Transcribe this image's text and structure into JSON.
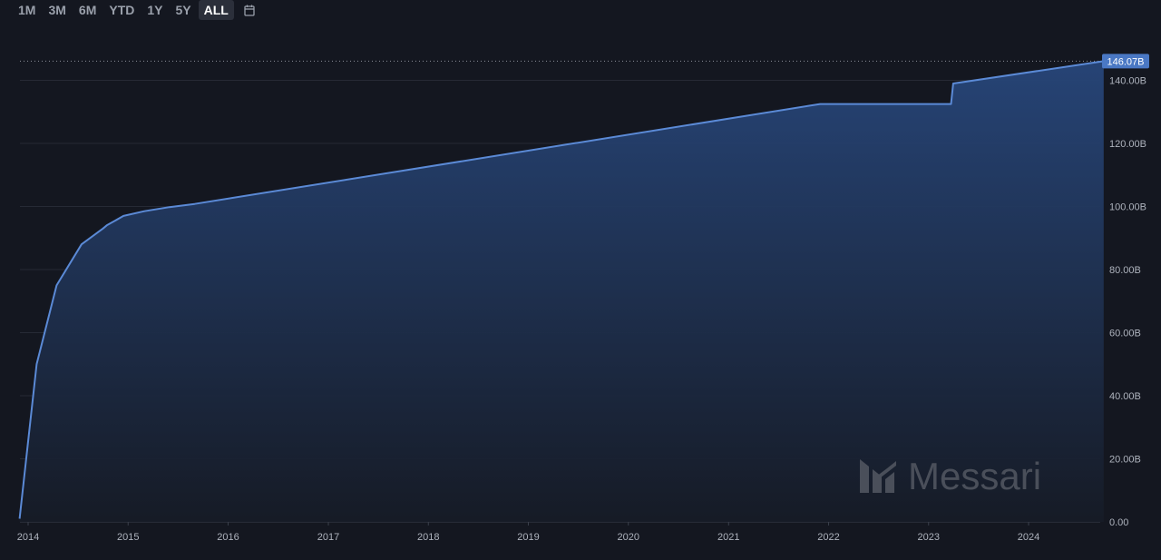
{
  "range_selector": {
    "buttons": [
      {
        "label": "1M",
        "active": false
      },
      {
        "label": "3M",
        "active": false
      },
      {
        "label": "6M",
        "active": false
      },
      {
        "label": "YTD",
        "active": false
      },
      {
        "label": "1Y",
        "active": false
      },
      {
        "label": "5Y",
        "active": false
      },
      {
        "label": "ALL",
        "active": true
      }
    ],
    "calendar_icon": "calendar-icon"
  },
  "watermark": "Messari",
  "colors": {
    "background": "#141720",
    "line": "#5b8ad6",
    "area_top": "#27467a",
    "area_bottom": "#161b26",
    "grid": "#262a35",
    "last_value_badge": "#4a78c4"
  },
  "chart_data": {
    "type": "area",
    "title": "",
    "xlabel": "",
    "ylabel": "",
    "x_ticks": [
      "2014",
      "2015",
      "2016",
      "2017",
      "2018",
      "2019",
      "2020",
      "2021",
      "2022",
      "2023",
      "2024"
    ],
    "y_ticks": [
      "0.00",
      "20.00B",
      "40.00B",
      "60.00B",
      "80.00B",
      "100.00B",
      "120.00B",
      "140.00B"
    ],
    "ylim": [
      0,
      160
    ],
    "y_unit": "B",
    "last_value_label": "146.07B",
    "grid": true,
    "series": [
      {
        "points": [
          {
            "x": "2013-12-01",
            "y": 1.0
          },
          {
            "x": "2014-02-01",
            "y": 50.0
          },
          {
            "x": "2014-04-15",
            "y": 75.0
          },
          {
            "x": "2014-07-15",
            "y": 88.0
          },
          {
            "x": "2014-10-01",
            "y": 93.0
          },
          {
            "x": "2014-10-15",
            "y": 94.0
          },
          {
            "x": "2014-12-15",
            "y": 97.0
          },
          {
            "x": "2015-03-01",
            "y": 98.5
          },
          {
            "x": "2015-06-01",
            "y": 99.8
          },
          {
            "x": "2015-09-01",
            "y": 100.8
          },
          {
            "x": "2021-12-01",
            "y": 132.5
          },
          {
            "x": "2023-03-24",
            "y": 132.5
          },
          {
            "x": "2023-04-01",
            "y": 139.0
          },
          {
            "x": "2024-10-01",
            "y": 146.07
          }
        ]
      }
    ]
  }
}
